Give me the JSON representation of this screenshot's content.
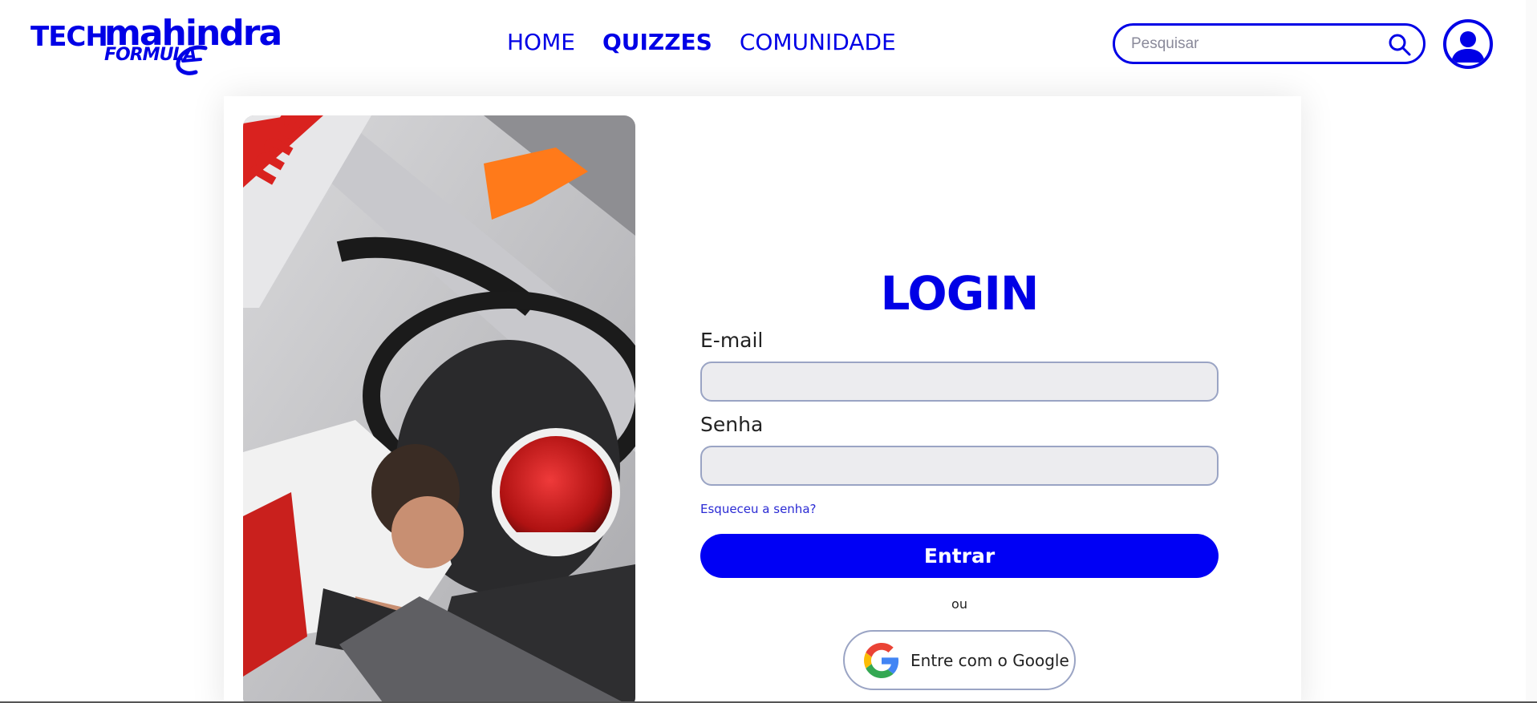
{
  "header": {
    "logo": {
      "tech": "TECH",
      "mahindra": "mahindra",
      "formula": "FORMULA"
    },
    "nav": [
      {
        "label": "HOME"
      },
      {
        "label": "QUIZZES"
      },
      {
        "label": "COMUNIDADE"
      }
    ],
    "search": {
      "placeholder": "Pesquisar",
      "value": ""
    }
  },
  "login": {
    "title": "LOGIN",
    "email_label": "E-mail",
    "email_value": "",
    "password_label": "Senha",
    "password_value": "",
    "forgot_link": "Esqueceu a senha?",
    "submit_label": "Entrar",
    "or_text": "ou",
    "google_label": "Entre com o Google"
  },
  "colors": {
    "accent": "#0000e6",
    "button": "#0000f5",
    "input_bg": "#ececef",
    "input_border": "#9aa4c4"
  },
  "icons": {
    "search": "search-icon",
    "avatar": "user-avatar-icon",
    "google": "google-icon"
  }
}
